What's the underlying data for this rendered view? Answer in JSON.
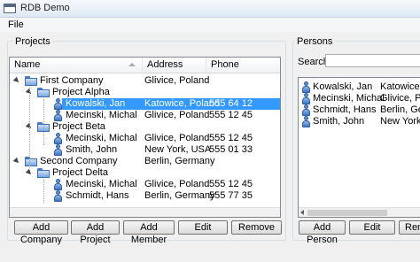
{
  "window": {
    "title": "RDB Demo"
  },
  "menu": {
    "file": "File"
  },
  "projects": {
    "group_title": "Projects",
    "columns": [
      "Name",
      "Address",
      "Phone"
    ],
    "rows": [
      {
        "name": "First Company",
        "address": "Glivice, Poland",
        "phone": "",
        "kind": "folder",
        "level": 0
      },
      {
        "name": "Project Alpha",
        "address": "",
        "phone": "",
        "kind": "folder",
        "level": 1
      },
      {
        "name": "Kowalski, Jan",
        "address": "Katowice, Poland",
        "phone": "555 64 12",
        "kind": "person",
        "level": 2,
        "selected": true
      },
      {
        "name": "Mecinski, Michal",
        "address": "Glivice, Poland",
        "phone": "555 12 45",
        "kind": "person",
        "level": 2
      },
      {
        "name": "Project Beta",
        "address": "",
        "phone": "",
        "kind": "folder",
        "level": 1
      },
      {
        "name": "Mecinski, Michal",
        "address": "Glivice, Poland",
        "phone": "555 12 45",
        "kind": "person",
        "level": 2
      },
      {
        "name": "Smith, John",
        "address": "New York, USA",
        "phone": "555 01 33",
        "kind": "person",
        "level": 2
      },
      {
        "name": "Second Company",
        "address": "Berlin, Germany",
        "phone": "",
        "kind": "folder",
        "level": 0
      },
      {
        "name": "Project Delta",
        "address": "",
        "phone": "",
        "kind": "folder",
        "level": 1
      },
      {
        "name": "Mecinski, Michal",
        "address": "Glivice, Poland",
        "phone": "555 12 45",
        "kind": "person",
        "level": 2
      },
      {
        "name": "Schmidt, Hans",
        "address": "Berlin, Germany",
        "phone": "555 77 35",
        "kind": "person",
        "level": 2
      }
    ],
    "buttons": {
      "add_company": "Add Company",
      "add_project": "Add Project",
      "add_member": "Add Member",
      "edit": "Edit",
      "remove": "Remove"
    }
  },
  "persons": {
    "group_title": "Persons",
    "search_label": "Search:",
    "search_value": "",
    "rows": [
      {
        "name": "Kowalski, Jan",
        "address": "Katowice"
      },
      {
        "name": "Mecinski, Michal",
        "address": "Glivice, P"
      },
      {
        "name": "Schmidt, Hans",
        "address": "Berlin, Ge"
      },
      {
        "name": "Smith, John",
        "address": "New York,"
      }
    ],
    "buttons": {
      "add_person": "Add Person",
      "edit": "Edit",
      "remove": "Remo"
    }
  },
  "colors": {
    "selection": "#3399ff",
    "button_border": "#707070"
  }
}
